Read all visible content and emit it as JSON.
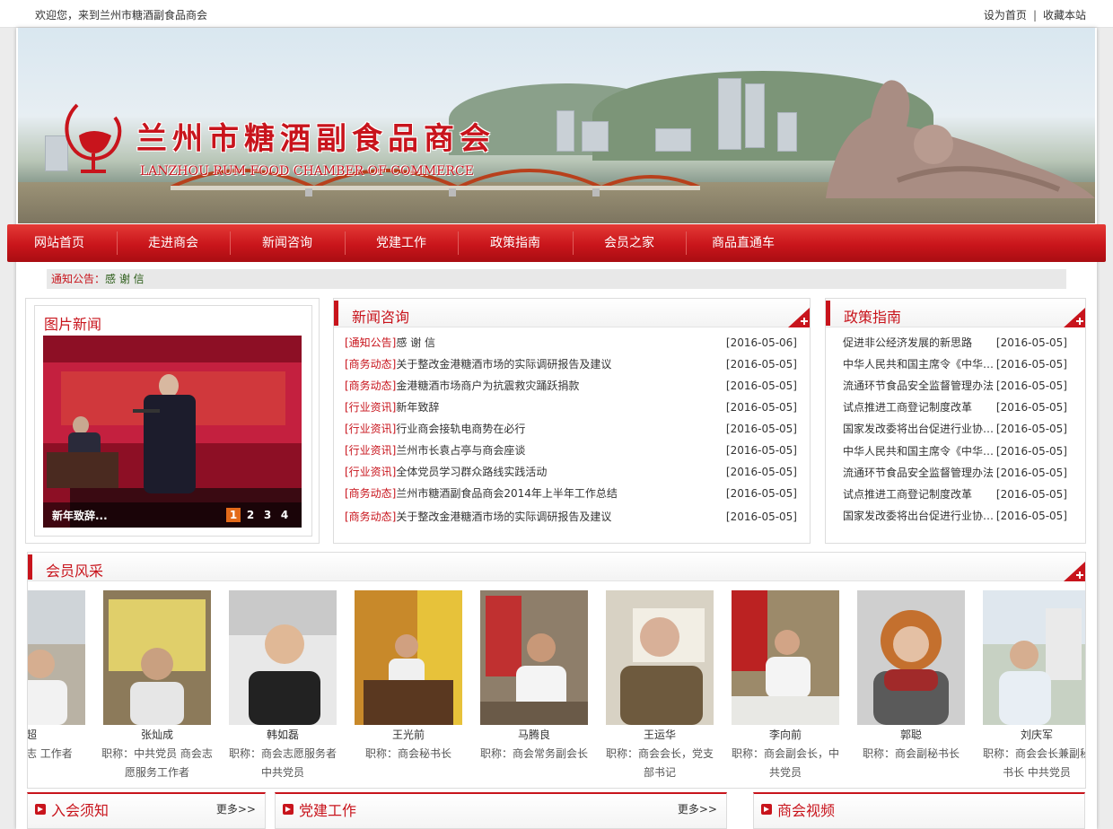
{
  "topbar": {
    "welcome": "欢迎您，来到兰州市糖酒副食品商会",
    "set_home": "设为首页",
    "separator": "|",
    "bookmark": "收藏本站"
  },
  "banner": {
    "title_cn": "兰州市糖酒副食品商会",
    "title_en": "LANZHOU RUM FOOD CHAMBER OF COMMERCE"
  },
  "nav": {
    "items": [
      "网站首页",
      "走进商会",
      "新闻咨询",
      "党建工作",
      "政策指南",
      "会员之家",
      "商品直通车"
    ]
  },
  "notice": {
    "label": "通知公告：",
    "text": "感 谢 信"
  },
  "pic_news": {
    "title": "图片新闻",
    "caption": "新年致辞...",
    "pages": [
      "1",
      "2",
      "3",
      "4"
    ],
    "active_page": 1
  },
  "news": {
    "title": "新闻咨询",
    "items": [
      {
        "cat": "[通知公告]",
        "title": "感 谢 信",
        "date": "[2016-05-06]"
      },
      {
        "cat": "[商务动态]",
        "title": "关于整改金港糖酒市场的实际调研报告及建议",
        "date": "[2016-05-05]"
      },
      {
        "cat": "[商务动态]",
        "title": "金港糖酒市场商户为抗震救灾踊跃捐款",
        "date": "[2016-05-05]"
      },
      {
        "cat": "[行业资讯]",
        "title": "新年致辞",
        "date": "[2016-05-05]"
      },
      {
        "cat": "[行业资讯]",
        "title": "行业商会接轨电商势在必行",
        "date": "[2016-05-05]"
      },
      {
        "cat": "[行业资讯]",
        "title": "兰州市长袁占亭与商会座谈",
        "date": "[2016-05-05]"
      },
      {
        "cat": "[行业资讯]",
        "title": "全体党员学习群众路线实践活动",
        "date": "[2016-05-05]"
      },
      {
        "cat": "[商务动态]",
        "title": "兰州市糖酒副食品商会2014年上半年工作总结",
        "date": "[2016-05-05]"
      },
      {
        "cat": "[商务动态]",
        "title": "关于整改金港糖酒市场的实际调研报告及建议",
        "date": "[2016-05-05]"
      }
    ]
  },
  "policy": {
    "title": "政策指南",
    "items": [
      {
        "title": "促进非公经济发展的新思路",
        "date": "[2016-05-05]"
      },
      {
        "title": "中华人民共和国主席令《中华…",
        "date": "[2016-05-05]"
      },
      {
        "title": "流通环节食品安全监督管理办法",
        "date": "[2016-05-05]"
      },
      {
        "title": "试点推进工商登记制度改革",
        "date": "[2016-05-05]"
      },
      {
        "title": "国家发改委将出台促进行业协…",
        "date": "[2016-05-05]"
      },
      {
        "title": "中华人民共和国主席令《中华…",
        "date": "[2016-05-05]"
      },
      {
        "title": "流通环节食品安全监督管理办法",
        "date": "[2016-05-05]"
      },
      {
        "title": "试点推进工商登记制度改革",
        "date": "[2016-05-05]"
      },
      {
        "title": "国家发改委将出台促进行业协…",
        "date": "[2016-05-05]"
      }
    ]
  },
  "members": {
    "title": "会员风采",
    "items": [
      {
        "name": "超",
        "role": "员 商会志 工作者"
      },
      {
        "name": "张灿成",
        "role": "职称：中共党员 商会志愿服务工作者"
      },
      {
        "name": "韩如磊",
        "role": "职称：商会志愿服务者 中共党员"
      },
      {
        "name": "王光前",
        "role": "职称：商会秘书长"
      },
      {
        "name": "马腾良",
        "role": "职称：商会常务副会长"
      },
      {
        "name": "王运华",
        "role": "职称：商会会长，党支部书记"
      },
      {
        "name": "李向前",
        "role": "职称：商会副会长，中共党员"
      },
      {
        "name": "郭聪",
        "role": "职称：商会副秘书长"
      },
      {
        "name": "刘庆军",
        "role": "职称：商会会长兼副秘书长 中共党员"
      }
    ]
  },
  "bottom": {
    "join": {
      "title": "入会须知",
      "more": "更多>>"
    },
    "party": {
      "title": "党建工作",
      "more": "更多>>"
    },
    "video": {
      "title": "商会视频"
    }
  },
  "colors": {
    "brand_red": "#c8141c",
    "nav_red": "#c9151b",
    "notice_green": "#2a5b16"
  }
}
